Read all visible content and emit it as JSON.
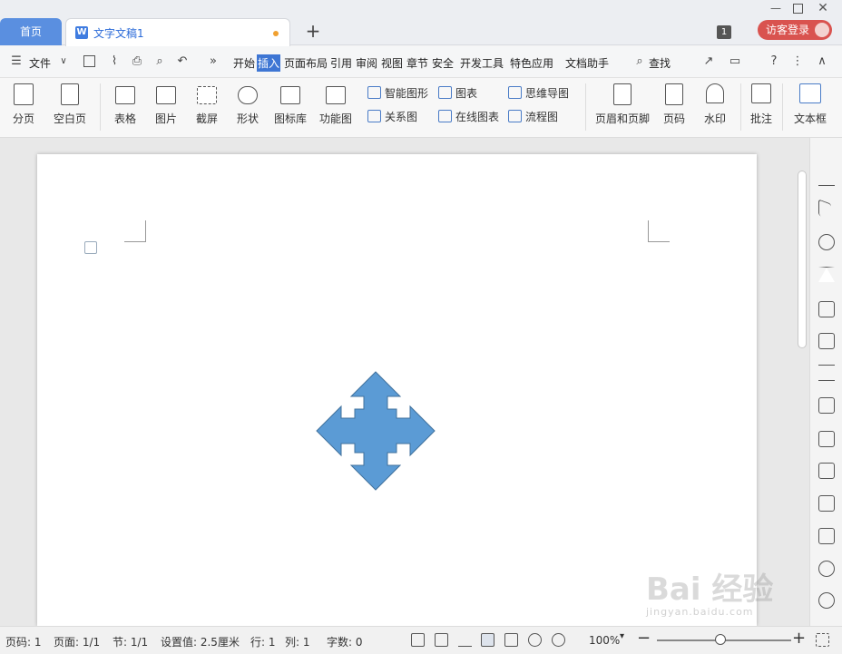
{
  "tabs": {
    "home": "首页",
    "doc": "文字文稿1",
    "new": "+"
  },
  "window": {
    "page_count_badge": "1",
    "login": "访客登录"
  },
  "menu": {
    "file": "文件",
    "items": [
      "开始",
      "插入",
      "页面布局",
      "引用",
      "审阅",
      "视图",
      "章节",
      "安全",
      "开发工具",
      "特色应用",
      "文档助手"
    ],
    "active": "插入",
    "search": "查找",
    "more": "»"
  },
  "ribbon": {
    "big": [
      "分页",
      "空白页",
      "表格",
      "图片",
      "截屏",
      "形状",
      "图标库",
      "功能图",
      "页眉和页脚",
      "页码",
      "水印",
      "批注",
      "文本框"
    ],
    "small": [
      "智能图形",
      "图表",
      "思维导图",
      "关系图",
      "在线图表",
      "流程图"
    ]
  },
  "document": {
    "shape": "four-way-arrow",
    "shape_color": "#5b9bd5"
  },
  "status": {
    "page_num": "页码: 1",
    "pages": "页面: 1/1",
    "section": "节: 1/1",
    "setting": "设置值: 2.5厘米",
    "row": "行: 1",
    "col": "列: 1",
    "words": "字数: 0",
    "zoom": "100%"
  },
  "watermark": {
    "main": "Bai 经验",
    "sub": "jingyan.baidu.com"
  }
}
